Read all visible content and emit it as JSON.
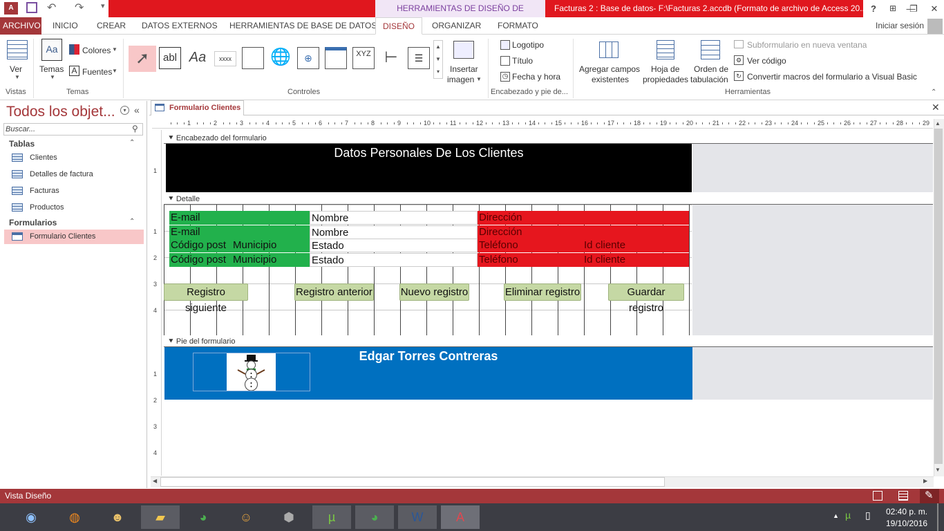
{
  "titlebar": {
    "context_tab": "HERRAMIENTAS DE DISEÑO DE FORMULARIO",
    "window_title": "Facturas 2 : Base de datos- F:\\Facturas 2.accdb (Formato de archivo de Access 20...",
    "help": "?"
  },
  "tabs": {
    "archivo": "ARCHIVO",
    "inicio": "INICIO",
    "crear": "CREAR",
    "datos_externos": "DATOS EXTERNOS",
    "herramientas_bd": "HERRAMIENTAS DE BASE DE DATOS",
    "diseno": "DISEÑO",
    "organizar": "ORGANIZAR",
    "formato": "FORMATO",
    "signin": "Iniciar sesión"
  },
  "ribbon": {
    "ver": "Ver",
    "temas": "Temas",
    "colores": "Colores",
    "fuentes": "Fuentes",
    "insertar_imagen_1": "Insertar",
    "insertar_imagen_2": "imagen",
    "logotipo": "Logotipo",
    "titulo": "Título",
    "fecha_hora": "Fecha y hora",
    "agregar_campos_1": "Agregar campos",
    "agregar_campos_2": "existentes",
    "hoja_prop_1": "Hoja de",
    "hoja_prop_2": "propiedades",
    "orden_tab_1": "Orden de",
    "orden_tab_2": "tabulación",
    "subformulario": "Subformulario en nueva ventana",
    "ver_codigo": "Ver código",
    "convertir_macros": "Convertir macros del formulario a Visual Basic",
    "groups": {
      "vistas": "Vistas",
      "temas": "Temas",
      "controles": "Controles",
      "encabezado": "Encabezado y pie de...",
      "herramientas": "Herramientas"
    },
    "controls": {
      "textbox": "abl",
      "label": "Aa",
      "button": "xxxx",
      "xyz": "XYZ"
    }
  },
  "nav": {
    "title": "Todos los objet...",
    "search_placeholder": "Buscar...",
    "tablas_header": "Tablas",
    "tablas": [
      "Clientes",
      "Detalles de factura",
      "Facturas",
      "Productos"
    ],
    "formularios_header": "Formularios",
    "formularios": [
      "Formulario Clientes"
    ]
  },
  "document": {
    "tab": "Formulario Clientes",
    "ruler_numbers": [
      "1",
      "2",
      "3",
      "4",
      "5",
      "6",
      "7",
      "8",
      "9",
      "10",
      "11",
      "12",
      "13",
      "14",
      "15",
      "16",
      "17",
      "18",
      "19",
      "20",
      "21",
      "22",
      "23",
      "24",
      "25",
      "26",
      "27",
      "28",
      "29"
    ],
    "vruler_header": [
      "1"
    ],
    "vruler_detail": [
      "1",
      "2",
      "3",
      "4"
    ],
    "vruler_footer": [
      "1",
      "2",
      "3",
      "4"
    ],
    "header_section": "Encabezado del formulario",
    "header_title": "Datos Personales De Los Clientes",
    "detail_section": "Detalle",
    "footer_section": "Pie del formulario",
    "footer_title": "Edgar Torres Contreras",
    "fields": {
      "email": "E-mail",
      "nombre": "Nombre",
      "direccion": "Dirección",
      "codigo_postal": "Código post",
      "municipio": "Municipio",
      "estado": "Estado",
      "telefono": "Teléfono",
      "id_cliente": "Id cliente"
    },
    "buttons": {
      "siguiente": "Registro siguiente",
      "anterior": "Registro anterior",
      "nuevo": "Nuevo registro",
      "eliminar": "Eliminar registro",
      "guardar": "Guardar registro"
    }
  },
  "status": {
    "text": "Vista Diseño"
  },
  "taskbar": {
    "time": "02:40 p. m.",
    "date": "19/10/2016"
  },
  "colors": {
    "access_red": "#a4373a",
    "title_red": "#e0171e",
    "green_label": "#22b14c",
    "red_label": "#e6161e",
    "footer_blue": "#0070c0",
    "button_green": "#c5d8a4"
  }
}
